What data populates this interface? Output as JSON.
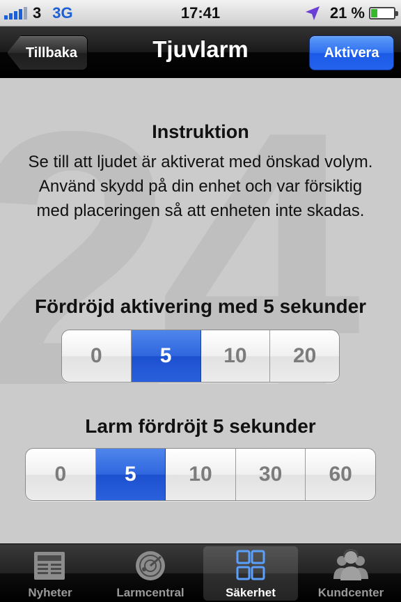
{
  "status_bar": {
    "carrier": "3",
    "network": "3G",
    "time": "17:41",
    "battery": "21 %",
    "battery_level_percent": 21,
    "signal_bars": 4
  },
  "nav_bar": {
    "back_label": "Tillbaka",
    "title": "Tjuvlarm",
    "action_label": "Aktivera"
  },
  "instruction": {
    "title": "Instruktion",
    "body": "Se till att ljudet är aktiverat med önskad volym. Använd skydd på din enhet och var försiktig med placeringen så att enheten inte skadas."
  },
  "activation_delay": {
    "label": "Fördröjd aktivering med 5 sekunder",
    "options": [
      "0",
      "5",
      "10",
      "20"
    ],
    "selected": "5"
  },
  "alarm_delay": {
    "label": "Larm fördröjt 5 sekunder",
    "options": [
      "0",
      "5",
      "10",
      "30",
      "60"
    ],
    "selected": "5"
  },
  "watermark": "24",
  "tab_bar": {
    "tabs": [
      {
        "label": "Nyheter",
        "icon": "newspaper-icon"
      },
      {
        "label": "Larmcentral",
        "icon": "radar-icon"
      },
      {
        "label": "Säkerhet",
        "icon": "grid-icon"
      },
      {
        "label": "Kundcenter",
        "icon": "people-headset-icon"
      }
    ],
    "active": "Säkerhet"
  },
  "colors": {
    "accent_blue": "#2f66de",
    "status_blue": "#1c5fd6",
    "battery_green": "#35b829",
    "background": "#cbcbcb"
  }
}
